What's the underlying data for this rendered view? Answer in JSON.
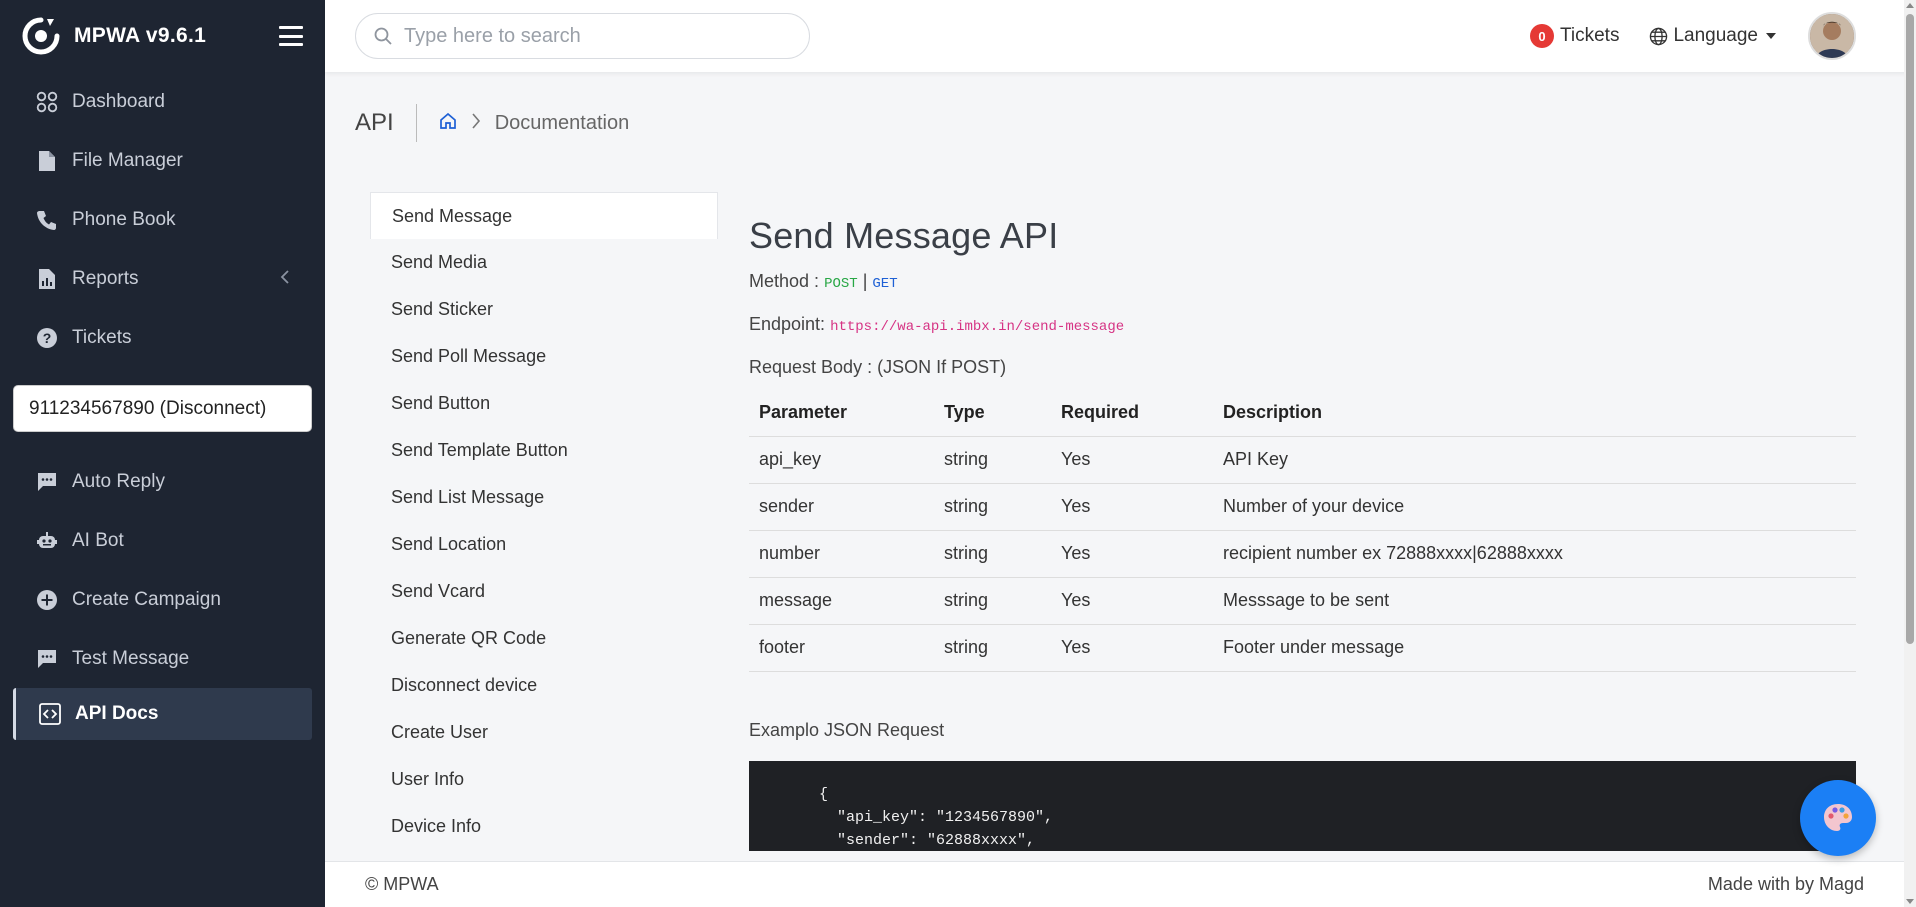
{
  "app": {
    "name": "MPWA v9.6.1"
  },
  "sidebar": {
    "items": [
      {
        "label": "Dashboard",
        "icon": "grid-icon"
      },
      {
        "label": "File Manager",
        "icon": "file-icon"
      },
      {
        "label": "Phone Book",
        "icon": "phone-icon"
      },
      {
        "label": "Reports",
        "icon": "chart-icon"
      },
      {
        "label": "Tickets",
        "icon": "question-icon"
      }
    ],
    "device": "911234567890 (Disconnect)",
    "items2": [
      {
        "label": "Auto Reply",
        "icon": "chat-icon"
      },
      {
        "label": "AI Bot",
        "icon": "robot-icon"
      },
      {
        "label": "Create Campaign",
        "icon": "plus-circle-icon"
      },
      {
        "label": "Test Message",
        "icon": "chat-icon"
      },
      {
        "label": "API Docs",
        "icon": "code-icon"
      }
    ]
  },
  "header": {
    "search_placeholder": "Type here to search",
    "tickets_count": "0",
    "tickets_label": "Tickets",
    "language_label": "Language"
  },
  "breadcrumb": {
    "page": "API",
    "current": "Documentation"
  },
  "docnav": [
    "Send Message",
    "Send Media",
    "Send Sticker",
    "Send Poll Message",
    "Send Button",
    "Send Template Button",
    "Send List Message",
    "Send Location",
    "Send Vcard",
    "Generate QR Code",
    "Disconnect device",
    "Create User",
    "User Info",
    "Device Info"
  ],
  "content": {
    "title": "Send Message API",
    "method_label": "Method :",
    "method_post": "POST",
    "method_sep": "|",
    "method_get": "GET",
    "endpoint_label": "Endpoint:",
    "endpoint_url": "https://wa-api.imbx.in/send-message",
    "request_body": "Request Body : (JSON If POST)",
    "table_headers": [
      "Parameter",
      "Type",
      "Required",
      "Description"
    ],
    "table_rows": [
      [
        "api_key",
        "string",
        "Yes",
        "API Key"
      ],
      [
        "sender",
        "string",
        "Yes",
        "Number of your device"
      ],
      [
        "number",
        "string",
        "Yes",
        "recipient number ex 72888xxxx|62888xxxx"
      ],
      [
        "message",
        "string",
        "Yes",
        "Messsage to be sent"
      ],
      [
        "footer",
        "string",
        "Yes",
        "Footer under message"
      ]
    ],
    "example_label": "Examplo JSON Request",
    "code_lines": [
      "{",
      "  \"api_key\": \"1234567890\",",
      "  \"sender\": \"62888xxxx\","
    ]
  },
  "footer": {
    "left": "© MPWA",
    "right": "Made with by Magd"
  }
}
